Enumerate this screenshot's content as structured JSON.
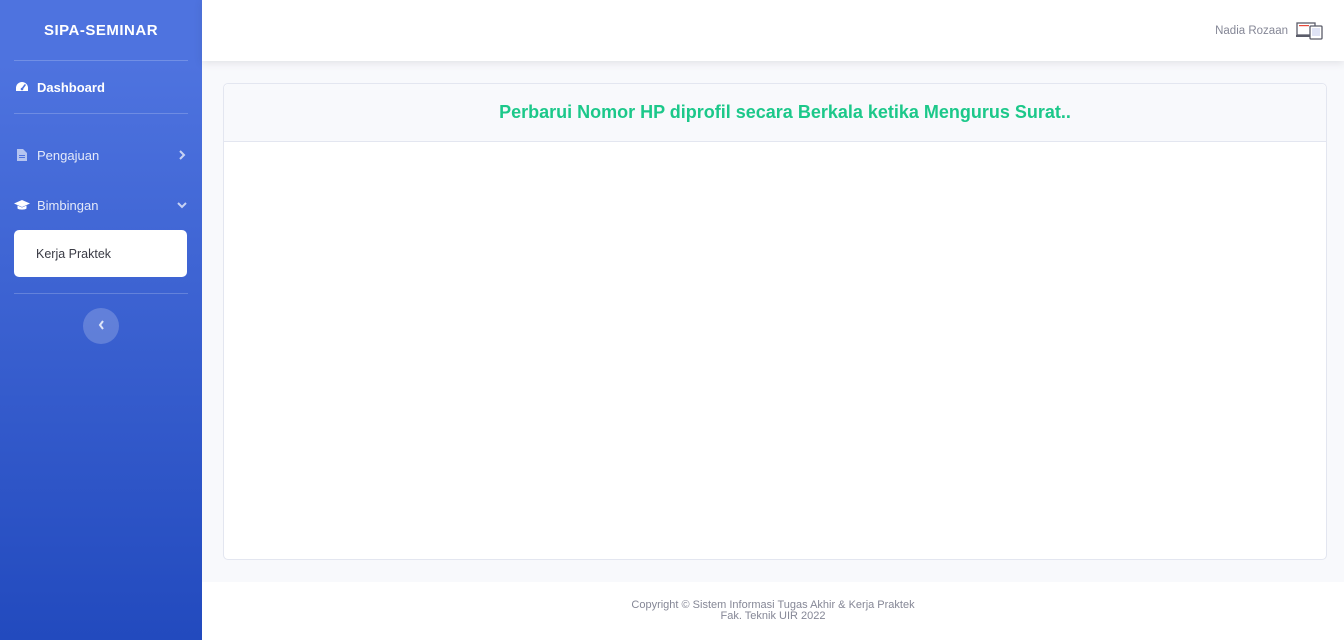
{
  "sidebar": {
    "brand": "SIPA-SEMINAR",
    "items": [
      {
        "label": "Dashboard",
        "icon": "tachometer-icon"
      },
      {
        "label": "Pengajuan",
        "icon": "file-icon",
        "chevron": "chevron-right-icon"
      },
      {
        "label": "Bimbingan",
        "icon": "graduation-cap-icon",
        "chevron": "chevron-down-icon",
        "submenu": [
          {
            "label": "Kerja Praktek"
          }
        ]
      }
    ],
    "toggle_icon": "chevron-left-icon"
  },
  "topbar": {
    "user_name": "Nadia Rozaan",
    "user_icon": "devices-icon"
  },
  "main": {
    "card_title": "Perbarui Nomor HP diprofil secara Berkala ketika Mengurus Surat.."
  },
  "footer": {
    "line1": "Copyright © Sistem Informasi Tugas Akhir & Kerja Praktek",
    "line2": "Fak. Teknik UIR 2022"
  },
  "colors": {
    "sidebar_top": "#4e73df",
    "sidebar_bottom": "#224abe",
    "title_green": "#1cc88a",
    "muted_text": "#858796"
  }
}
